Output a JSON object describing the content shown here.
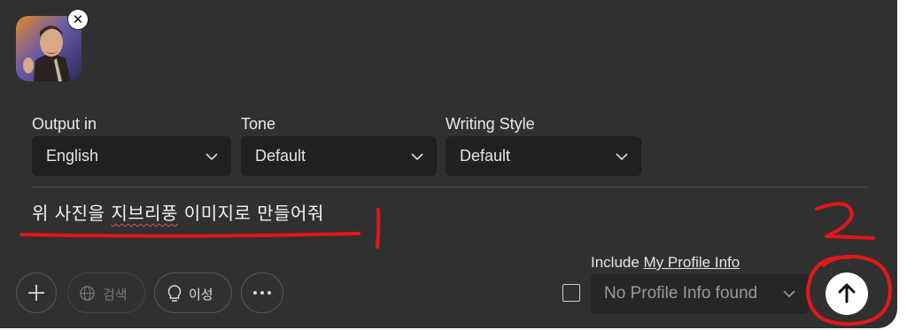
{
  "output": {
    "label": "Output in",
    "value": "English"
  },
  "tone": {
    "label": "Tone",
    "value": "Default"
  },
  "style": {
    "label": "Writing Style",
    "value": "Default"
  },
  "prompt": {
    "text_part1": "위 사진을 ",
    "text_spell": "지브리풍",
    "text_part2": " 이미지로 만들어줘"
  },
  "toolbar": {
    "search_label": "검색",
    "reason_label": "이성"
  },
  "profile": {
    "include_prefix": "Include ",
    "include_link": "My Profile Info",
    "value": "No Profile Info found"
  },
  "icons": {
    "remove_image": "close-icon",
    "add": "plus-icon",
    "search": "globe-icon",
    "reason": "lightbulb-icon",
    "more": "more-icon",
    "send": "arrow-up-icon"
  },
  "annotations": {
    "mark_1": "1",
    "mark_2": "2"
  }
}
